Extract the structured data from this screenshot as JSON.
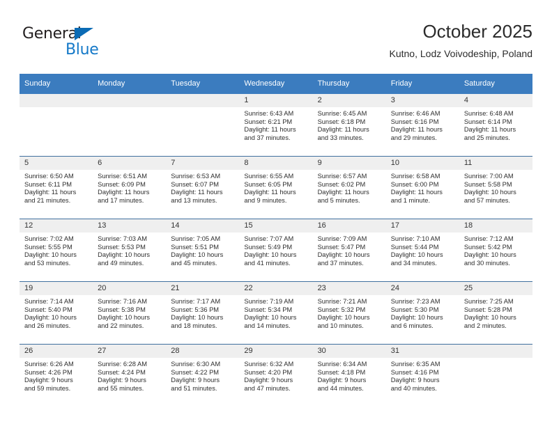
{
  "brand": {
    "name_top": "General",
    "name_bottom": "Blue",
    "accent_color": "#1579c8",
    "triangle_color": "#0b6bb5"
  },
  "header": {
    "title": "October 2025",
    "subtitle": "Kutno, Lodz Voivodeship, Poland"
  },
  "calendar": {
    "header_bg": "#3b7cbf",
    "daynum_bg": "#efefef",
    "row_rule_color": "#3f6f9e",
    "weekday_headers": [
      "Sunday",
      "Monday",
      "Tuesday",
      "Wednesday",
      "Thursday",
      "Friday",
      "Saturday"
    ],
    "weeks": [
      [
        {
          "day": "",
          "empty": true,
          "sunrise": "",
          "sunset": "",
          "daylight_line1": "",
          "daylight_line2": ""
        },
        {
          "day": "",
          "empty": true,
          "sunrise": "",
          "sunset": "",
          "daylight_line1": "",
          "daylight_line2": ""
        },
        {
          "day": "",
          "empty": true,
          "sunrise": "",
          "sunset": "",
          "daylight_line1": "",
          "daylight_line2": ""
        },
        {
          "day": "1",
          "empty": false,
          "sunrise": "Sunrise: 6:43 AM",
          "sunset": "Sunset: 6:21 PM",
          "daylight_line1": "Daylight: 11 hours",
          "daylight_line2": "and 37 minutes."
        },
        {
          "day": "2",
          "empty": false,
          "sunrise": "Sunrise: 6:45 AM",
          "sunset": "Sunset: 6:18 PM",
          "daylight_line1": "Daylight: 11 hours",
          "daylight_line2": "and 33 minutes."
        },
        {
          "day": "3",
          "empty": false,
          "sunrise": "Sunrise: 6:46 AM",
          "sunset": "Sunset: 6:16 PM",
          "daylight_line1": "Daylight: 11 hours",
          "daylight_line2": "and 29 minutes."
        },
        {
          "day": "4",
          "empty": false,
          "sunrise": "Sunrise: 6:48 AM",
          "sunset": "Sunset: 6:14 PM",
          "daylight_line1": "Daylight: 11 hours",
          "daylight_line2": "and 25 minutes."
        }
      ],
      [
        {
          "day": "5",
          "empty": false,
          "sunrise": "Sunrise: 6:50 AM",
          "sunset": "Sunset: 6:11 PM",
          "daylight_line1": "Daylight: 11 hours",
          "daylight_line2": "and 21 minutes."
        },
        {
          "day": "6",
          "empty": false,
          "sunrise": "Sunrise: 6:51 AM",
          "sunset": "Sunset: 6:09 PM",
          "daylight_line1": "Daylight: 11 hours",
          "daylight_line2": "and 17 minutes."
        },
        {
          "day": "7",
          "empty": false,
          "sunrise": "Sunrise: 6:53 AM",
          "sunset": "Sunset: 6:07 PM",
          "daylight_line1": "Daylight: 11 hours",
          "daylight_line2": "and 13 minutes."
        },
        {
          "day": "8",
          "empty": false,
          "sunrise": "Sunrise: 6:55 AM",
          "sunset": "Sunset: 6:05 PM",
          "daylight_line1": "Daylight: 11 hours",
          "daylight_line2": "and 9 minutes."
        },
        {
          "day": "9",
          "empty": false,
          "sunrise": "Sunrise: 6:57 AM",
          "sunset": "Sunset: 6:02 PM",
          "daylight_line1": "Daylight: 11 hours",
          "daylight_line2": "and 5 minutes."
        },
        {
          "day": "10",
          "empty": false,
          "sunrise": "Sunrise: 6:58 AM",
          "sunset": "Sunset: 6:00 PM",
          "daylight_line1": "Daylight: 11 hours",
          "daylight_line2": "and 1 minute."
        },
        {
          "day": "11",
          "empty": false,
          "sunrise": "Sunrise: 7:00 AM",
          "sunset": "Sunset: 5:58 PM",
          "daylight_line1": "Daylight: 10 hours",
          "daylight_line2": "and 57 minutes."
        }
      ],
      [
        {
          "day": "12",
          "empty": false,
          "sunrise": "Sunrise: 7:02 AM",
          "sunset": "Sunset: 5:55 PM",
          "daylight_line1": "Daylight: 10 hours",
          "daylight_line2": "and 53 minutes."
        },
        {
          "day": "13",
          "empty": false,
          "sunrise": "Sunrise: 7:03 AM",
          "sunset": "Sunset: 5:53 PM",
          "daylight_line1": "Daylight: 10 hours",
          "daylight_line2": "and 49 minutes."
        },
        {
          "day": "14",
          "empty": false,
          "sunrise": "Sunrise: 7:05 AM",
          "sunset": "Sunset: 5:51 PM",
          "daylight_line1": "Daylight: 10 hours",
          "daylight_line2": "and 45 minutes."
        },
        {
          "day": "15",
          "empty": false,
          "sunrise": "Sunrise: 7:07 AM",
          "sunset": "Sunset: 5:49 PM",
          "daylight_line1": "Daylight: 10 hours",
          "daylight_line2": "and 41 minutes."
        },
        {
          "day": "16",
          "empty": false,
          "sunrise": "Sunrise: 7:09 AM",
          "sunset": "Sunset: 5:47 PM",
          "daylight_line1": "Daylight: 10 hours",
          "daylight_line2": "and 37 minutes."
        },
        {
          "day": "17",
          "empty": false,
          "sunrise": "Sunrise: 7:10 AM",
          "sunset": "Sunset: 5:44 PM",
          "daylight_line1": "Daylight: 10 hours",
          "daylight_line2": "and 34 minutes."
        },
        {
          "day": "18",
          "empty": false,
          "sunrise": "Sunrise: 7:12 AM",
          "sunset": "Sunset: 5:42 PM",
          "daylight_line1": "Daylight: 10 hours",
          "daylight_line2": "and 30 minutes."
        }
      ],
      [
        {
          "day": "19",
          "empty": false,
          "sunrise": "Sunrise: 7:14 AM",
          "sunset": "Sunset: 5:40 PM",
          "daylight_line1": "Daylight: 10 hours",
          "daylight_line2": "and 26 minutes."
        },
        {
          "day": "20",
          "empty": false,
          "sunrise": "Sunrise: 7:16 AM",
          "sunset": "Sunset: 5:38 PM",
          "daylight_line1": "Daylight: 10 hours",
          "daylight_line2": "and 22 minutes."
        },
        {
          "day": "21",
          "empty": false,
          "sunrise": "Sunrise: 7:17 AM",
          "sunset": "Sunset: 5:36 PM",
          "daylight_line1": "Daylight: 10 hours",
          "daylight_line2": "and 18 minutes."
        },
        {
          "day": "22",
          "empty": false,
          "sunrise": "Sunrise: 7:19 AM",
          "sunset": "Sunset: 5:34 PM",
          "daylight_line1": "Daylight: 10 hours",
          "daylight_line2": "and 14 minutes."
        },
        {
          "day": "23",
          "empty": false,
          "sunrise": "Sunrise: 7:21 AM",
          "sunset": "Sunset: 5:32 PM",
          "daylight_line1": "Daylight: 10 hours",
          "daylight_line2": "and 10 minutes."
        },
        {
          "day": "24",
          "empty": false,
          "sunrise": "Sunrise: 7:23 AM",
          "sunset": "Sunset: 5:30 PM",
          "daylight_line1": "Daylight: 10 hours",
          "daylight_line2": "and 6 minutes."
        },
        {
          "day": "25",
          "empty": false,
          "sunrise": "Sunrise: 7:25 AM",
          "sunset": "Sunset: 5:28 PM",
          "daylight_line1": "Daylight: 10 hours",
          "daylight_line2": "and 2 minutes."
        }
      ],
      [
        {
          "day": "26",
          "empty": false,
          "sunrise": "Sunrise: 6:26 AM",
          "sunset": "Sunset: 4:26 PM",
          "daylight_line1": "Daylight: 9 hours",
          "daylight_line2": "and 59 minutes."
        },
        {
          "day": "27",
          "empty": false,
          "sunrise": "Sunrise: 6:28 AM",
          "sunset": "Sunset: 4:24 PM",
          "daylight_line1": "Daylight: 9 hours",
          "daylight_line2": "and 55 minutes."
        },
        {
          "day": "28",
          "empty": false,
          "sunrise": "Sunrise: 6:30 AM",
          "sunset": "Sunset: 4:22 PM",
          "daylight_line1": "Daylight: 9 hours",
          "daylight_line2": "and 51 minutes."
        },
        {
          "day": "29",
          "empty": false,
          "sunrise": "Sunrise: 6:32 AM",
          "sunset": "Sunset: 4:20 PM",
          "daylight_line1": "Daylight: 9 hours",
          "daylight_line2": "and 47 minutes."
        },
        {
          "day": "30",
          "empty": false,
          "sunrise": "Sunrise: 6:34 AM",
          "sunset": "Sunset: 4:18 PM",
          "daylight_line1": "Daylight: 9 hours",
          "daylight_line2": "and 44 minutes."
        },
        {
          "day": "31",
          "empty": false,
          "sunrise": "Sunrise: 6:35 AM",
          "sunset": "Sunset: 4:16 PM",
          "daylight_line1": "Daylight: 9 hours",
          "daylight_line2": "and 40 minutes."
        },
        {
          "day": "",
          "empty": true,
          "sunrise": "",
          "sunset": "",
          "daylight_line1": "",
          "daylight_line2": ""
        }
      ]
    ]
  }
}
